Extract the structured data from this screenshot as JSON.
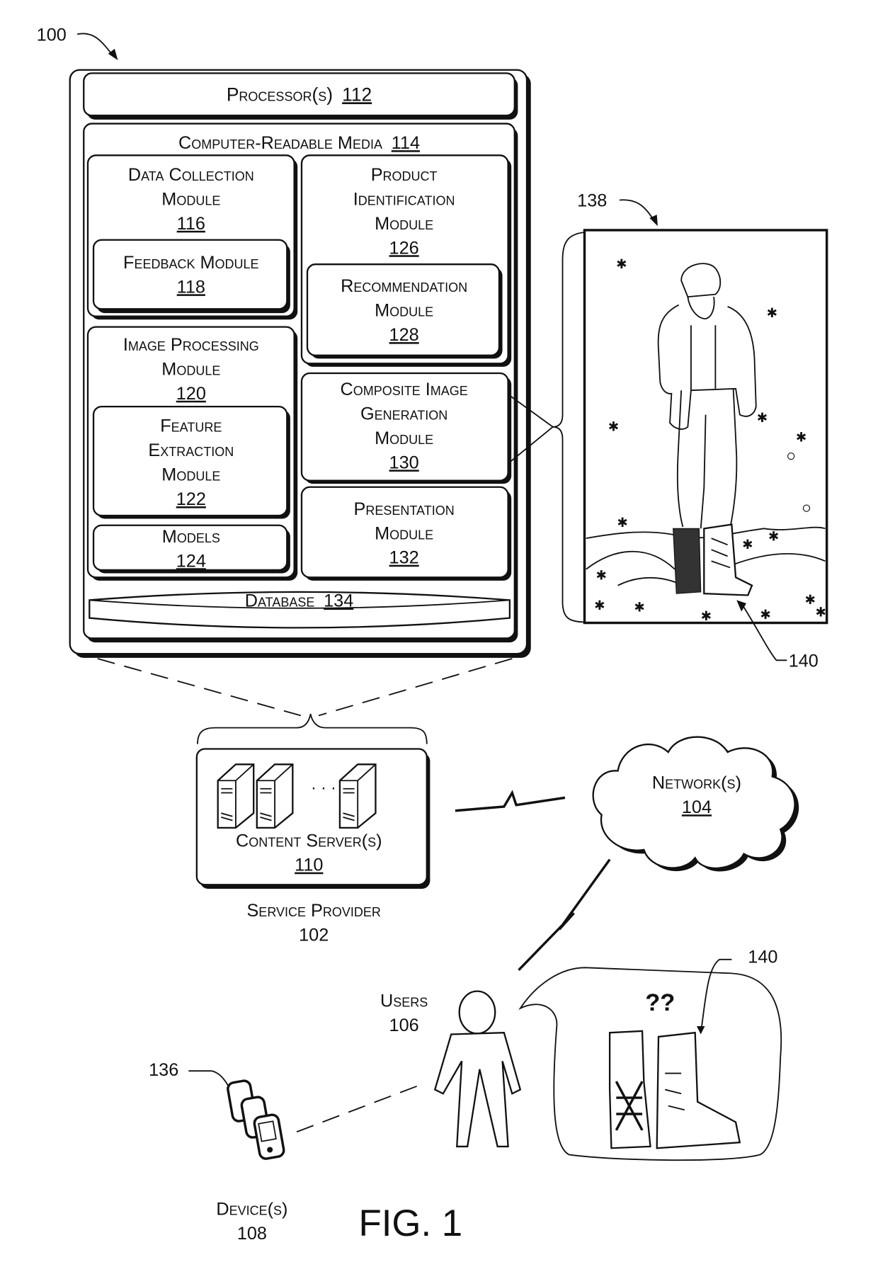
{
  "figure": {
    "title": "FIG. 1",
    "ref_system": "100"
  },
  "service_provider_detail": {
    "processor": {
      "label": "Processor(s)",
      "ref": "112"
    },
    "crm": {
      "label": "Computer-Readable Media",
      "ref": "114"
    },
    "modules": {
      "data_collection": {
        "lines": [
          "Data Collection",
          "Module"
        ],
        "ref": "116"
      },
      "feedback": {
        "lines": [
          "Feedback Module"
        ],
        "ref": "118"
      },
      "image_processing": {
        "lines": [
          "Image Processing",
          "Module"
        ],
        "ref": "120"
      },
      "feature_extraction": {
        "lines": [
          "Feature",
          "Extraction",
          "Module"
        ],
        "ref": "122"
      },
      "models": {
        "lines": [
          "Models"
        ],
        "ref": "124"
      },
      "product_identification": {
        "lines": [
          "Product",
          "Identification",
          "Module"
        ],
        "ref": "126"
      },
      "recommendation": {
        "lines": [
          "Recommendation",
          "Module"
        ],
        "ref": "128"
      },
      "composite_image": {
        "lines": [
          "Composite Image",
          "Generation",
          "Module"
        ],
        "ref": "130"
      },
      "presentation": {
        "lines": [
          "Presentation",
          "Module"
        ],
        "ref": "132"
      }
    },
    "database": {
      "label": "Database",
      "ref": "134"
    }
  },
  "composite_image": {
    "ref": "138",
    "product_ref": "140"
  },
  "content_servers": {
    "label": "Content Server(s)",
    "ref": "110",
    "ellipsis": "· · ·"
  },
  "service_provider": {
    "label": "Service Provider",
    "ref": "102"
  },
  "network": {
    "label": "Network(s)",
    "ref": "104"
  },
  "users": {
    "label": "Users",
    "ref": "106",
    "thought": "??",
    "product_ref": "140"
  },
  "devices": {
    "label": "Device(s)",
    "ref": "108",
    "device_ref": "136"
  }
}
